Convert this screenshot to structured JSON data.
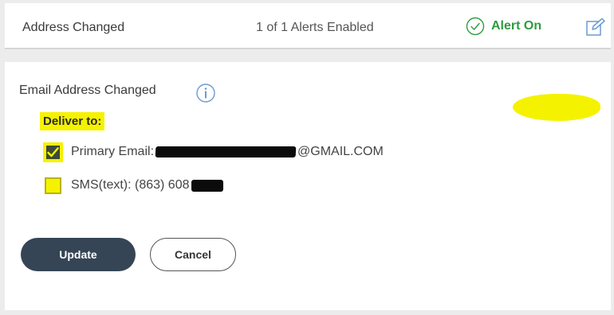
{
  "alert_summary": {
    "name": "Address Changed",
    "count_text": "1 of 1 Alerts Enabled",
    "status_text": "Alert On",
    "status_icon": "check-circle-icon",
    "edit_icon": "edit-icon",
    "status_color": "#2e9b3e"
  },
  "alert_detail": {
    "title": "Email Address Changed",
    "info_icon": "info-icon",
    "deliver_label": "Deliver to:",
    "options": [
      {
        "label_prefix": "Primary Email: ",
        "label_suffix": "@GMAIL.COM",
        "checked": true
      },
      {
        "label_prefix": "SMS(text): (863) 608",
        "label_suffix": "",
        "checked": false
      }
    ]
  },
  "actions": {
    "update_label": "Update",
    "cancel_label": "Cancel"
  },
  "colors": {
    "highlight": "#f5f200",
    "primary_button": "#354556"
  }
}
